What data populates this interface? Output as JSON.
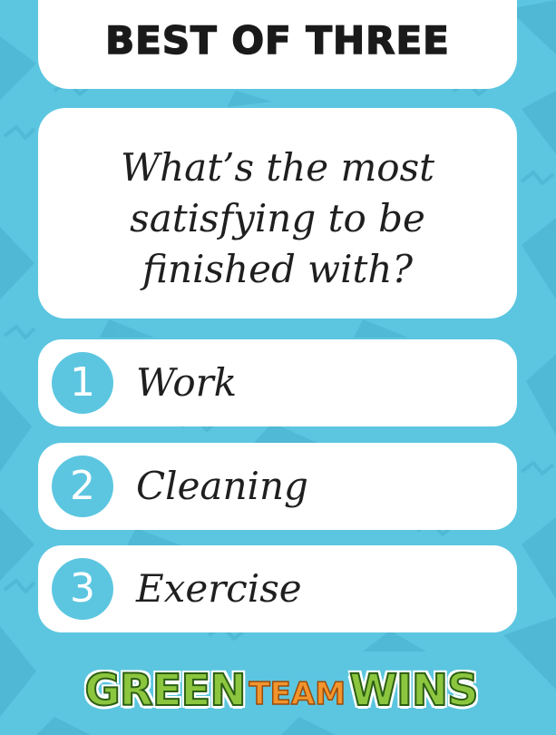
{
  "header": {
    "title": "BEST OF THREE"
  },
  "question": {
    "text": "What’s the most satisfying to be finished with?"
  },
  "options": [
    {
      "number": "1",
      "label": "Work"
    },
    {
      "number": "2",
      "label": "Cleaning"
    },
    {
      "number": "3",
      "label": "Exercise"
    }
  ],
  "logo": {
    "green": "GREEN",
    "team": "TEAM",
    "wins": "WINS"
  },
  "colors": {
    "background": "#5cc6e0",
    "card": "#ffffff",
    "number_circle": "#5cc6e0",
    "logo_green": "#8cc63f",
    "logo_orange": "#f2952c"
  }
}
